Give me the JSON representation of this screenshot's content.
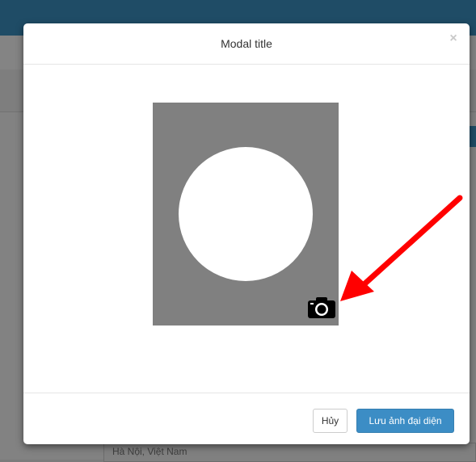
{
  "modal": {
    "title": "Modal title",
    "close_label": "×",
    "footer": {
      "cancel_label": "Hủy",
      "save_label": "Lưu ảnh đại diện"
    }
  },
  "preview": {
    "camera_icon": "camera-icon",
    "annotation": "red-arrow-pointing-to-camera"
  },
  "background": {
    "field_text": "Hà Nội, Việt Nam"
  },
  "colors": {
    "topbar": "#1f4c66",
    "overlay": "#808080",
    "primary_button": "#3c8dc5",
    "arrow": "#ff0000"
  }
}
